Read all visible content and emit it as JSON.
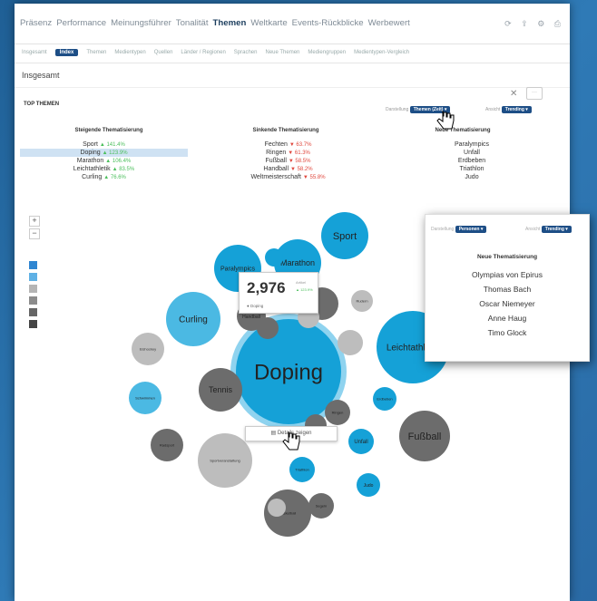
{
  "topnav": {
    "items": [
      "Präsenz",
      "Performance",
      "Meinungsführer",
      "Tonalität",
      "Themen",
      "Weltkarte",
      "Events-Rückblicke",
      "Werbewert"
    ],
    "active_index": 4,
    "icons": [
      "refresh-icon",
      "share-icon",
      "settings-icon",
      "print-icon"
    ]
  },
  "subnav": {
    "items": [
      "Insgesamt",
      "Index",
      "Themen",
      "Medientypen",
      "Quellen",
      "Länder / Regionen",
      "Sprachen",
      "Neue Themen",
      "Mediengruppen",
      "Medientypen-Vergleich"
    ],
    "active_index": 1
  },
  "page_title": "Insgesamt",
  "controls": {
    "close": "✕",
    "more": "···"
  },
  "section": {
    "label": "TOP THEMEN",
    "filter1_label": "Darstellung",
    "filter1_value": "Themen (Zeit) ▾",
    "filter2_label": "Ansicht",
    "filter2_value": "Trending ▾"
  },
  "columns": {
    "rising": {
      "header": "Steigende Thematisierung",
      "rows": [
        {
          "name": "Sport",
          "change": "▲ 141.4%"
        },
        {
          "name": "Doping",
          "change": "▲ 123.9%",
          "selected": true
        },
        {
          "name": "Marathon",
          "change": "▲ 106.4%"
        },
        {
          "name": "Leichtathletik",
          "change": "▲ 83.5%"
        },
        {
          "name": "Curling",
          "change": "▲ 76.6%"
        }
      ]
    },
    "falling": {
      "header": "Sinkende Thematisierung",
      "rows": [
        {
          "name": "Fechten",
          "change": "▼ 63.7%"
        },
        {
          "name": "Ringen",
          "change": "▼ 61.3%"
        },
        {
          "name": "Fußball",
          "change": "▼ 58.5%"
        },
        {
          "name": "Handball",
          "change": "▼ 58.2%"
        },
        {
          "name": "Weltmeisterschaft",
          "change": "▼ 55.8%"
        }
      ]
    },
    "new": {
      "header": "Neue Thematisierung",
      "rows": [
        "Paralympics",
        "Unfall",
        "Erdbeben",
        "Triathlon",
        "Judo"
      ]
    }
  },
  "map_controls": {
    "zoom_in": "+",
    "zoom_out": "−"
  },
  "tooltip": {
    "value": "2,976",
    "label": "Artikel",
    "change": "▲ 123.9%",
    "tag": "● Doping"
  },
  "details_button": "Details zeigen",
  "popup": {
    "filter1_label": "Darstellung",
    "filter1_value": "Personen ▾",
    "filter2_label": "Ansicht",
    "filter2_value": "Trending ▾",
    "header": "Neue Thematisierung",
    "items": [
      "Olympias von Epirus",
      "Thomas Bach",
      "Oscar Niemeyer",
      "Anne Haug",
      "Timo Glock"
    ]
  },
  "bubbles": [
    {
      "label": "Doping",
      "color": "#15a1d7",
      "ring": true
    },
    {
      "label": "Sport",
      "color": "#15a1d7"
    },
    {
      "label": "Marathon",
      "color": "#15a1d7"
    },
    {
      "label": "Paralympics",
      "color": "#15a1d7"
    },
    {
      "label": "Curling",
      "color": "#4bb9e3"
    },
    {
      "label": "Leichtathletik",
      "color": "#15a1d7"
    },
    {
      "label": "Fußball",
      "color": "#6c6c6c"
    },
    {
      "label": "Tennis",
      "color": "#6c6c6c"
    },
    {
      "label": "Unfall",
      "color": "#15a1d7"
    },
    {
      "label": "Schwimmen",
      "color": "#4bb9e3"
    },
    {
      "label": "Eishockey",
      "color": "#bdbdbd"
    },
    {
      "label": "Handball",
      "color": "#6c6c6c"
    },
    {
      "label": "Ringen",
      "color": "#6c6c6c"
    },
    {
      "label": "Rudern",
      "color": "#bdbdbd"
    },
    {
      "label": "Formel 1",
      "color": "#bdbdbd"
    },
    {
      "label": "Radsport",
      "color": "#6c6c6c"
    },
    {
      "label": "Sportveranstaltung",
      "color": "#bdbdbd"
    },
    {
      "label": "Triathlon",
      "color": "#15a1d7"
    },
    {
      "label": "Judo",
      "color": "#15a1d7"
    },
    {
      "label": "Basketball",
      "color": "#6c6c6c"
    },
    {
      "label": "Erdbeben",
      "color": "#15a1d7"
    },
    {
      "label": "Weltmeisterschaft",
      "color": "#6c6c6c"
    },
    {
      "label": "Segeln",
      "color": "#6c6c6c"
    },
    {
      "label": "",
      "color": "#6c6c6c"
    },
    {
      "label": "",
      "color": "#bdbdbd"
    },
    {
      "label": "",
      "color": "#15a1d7"
    },
    {
      "label": "",
      "color": "#6c6c6c"
    },
    {
      "label": "",
      "color": "#bdbdbd"
    }
  ]
}
